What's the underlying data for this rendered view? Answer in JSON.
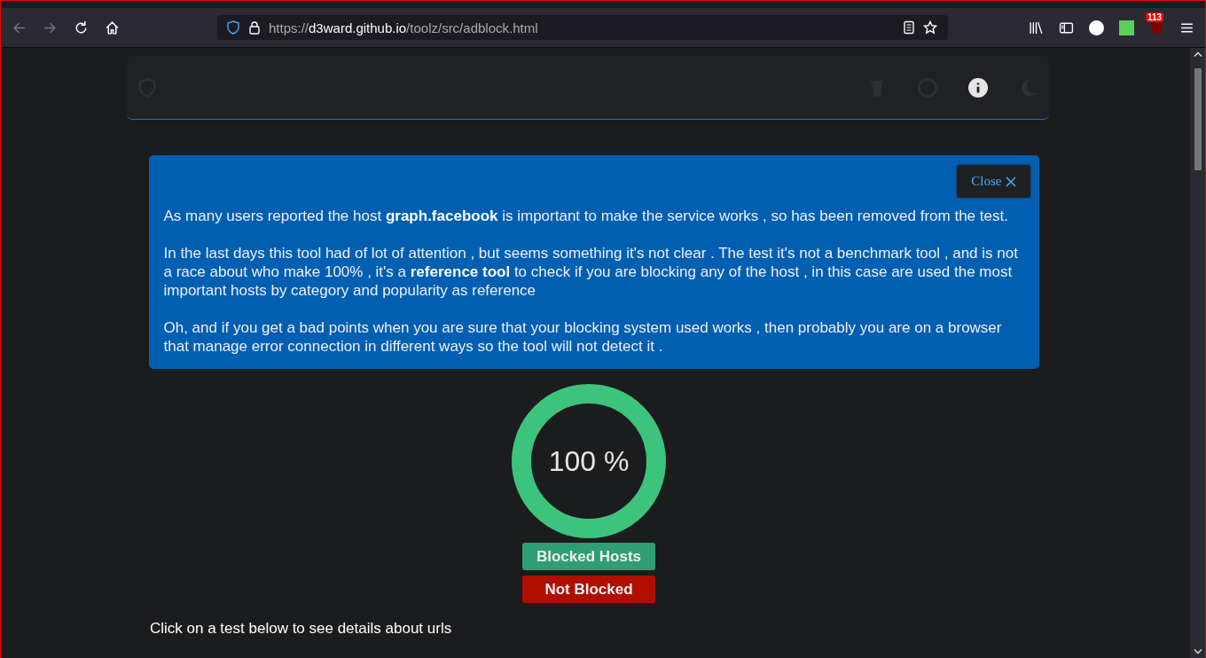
{
  "browser": {
    "url": {
      "scheme": "https://",
      "host": "d3ward.github.io",
      "path": "/toolz/src/adblock.html"
    },
    "extension_badge": "113"
  },
  "notice": {
    "close_label": "Close",
    "paragraphs": [
      "As many users reported the host **graph.facebook** is important to make the service works , so has been removed from the test.",
      "In the last days this tool had of lot of attention , but seems something it's not clear . The test it's not a benchmark tool , and is not a race about who make 100% , it's a **reference tool** to check if you are blocking any of the host , in this case are used the most important hosts by category and popularity as reference",
      "Oh, and if you get a bad points when you are sure that your blocking system used works , then probably you are on a browser that manage error connection in different ways so the tool will not detect it ."
    ]
  },
  "score": {
    "label": "100 %",
    "level": 1
  },
  "legend": [
    {
      "label": "Blocked Hosts",
      "color": "#2e9e73"
    },
    {
      "label": "Not Blocked",
      "color": "#b00f00"
    }
  ],
  "hint": "Click on a test below to see details about urls"
}
